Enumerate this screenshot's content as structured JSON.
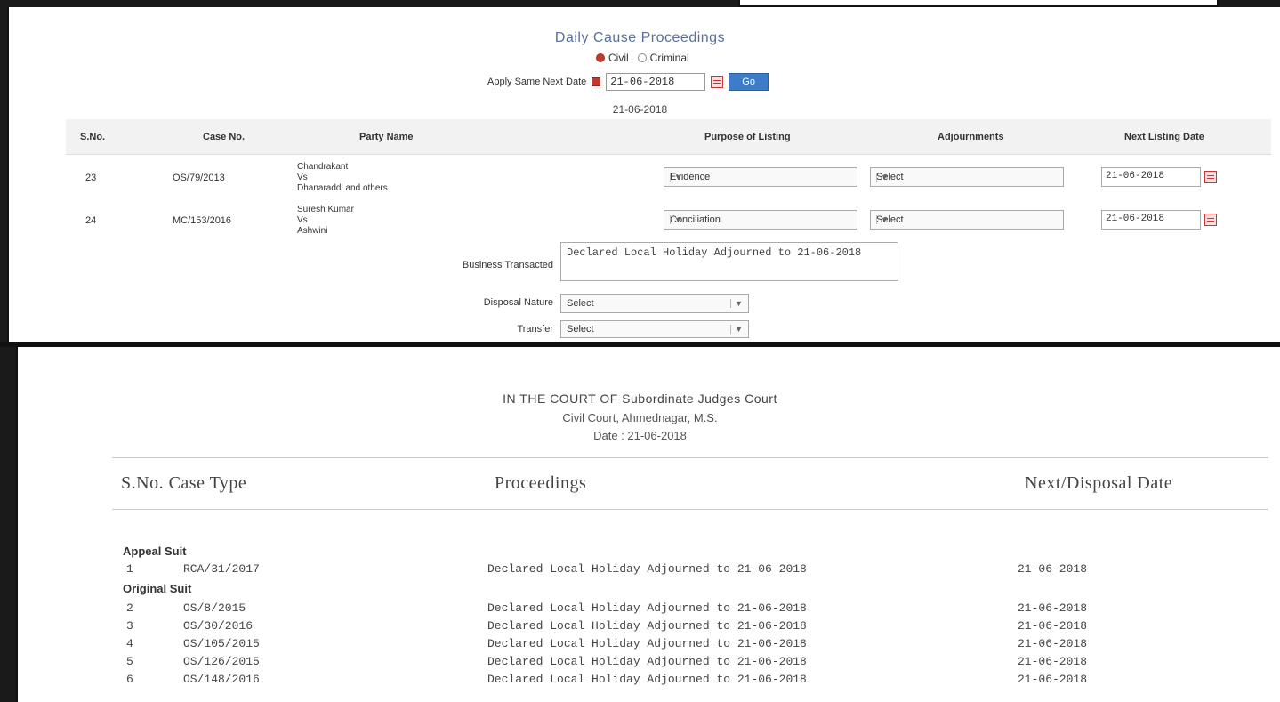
{
  "top": {
    "title": "Daily Cause Proceedings",
    "radio_1": "Civil",
    "radio_2": "Criminal",
    "same_next_date_label": "Apply Same Next Date",
    "same_next_date_value": "21-06-2018",
    "go_button": "Go",
    "selected_date": "21-06-2018",
    "columns": [
      "S.No.",
      "Case No.",
      "Party Name",
      "Purpose of Listing",
      "Adjournments",
      "Next Listing Date"
    ],
    "rows": [
      {
        "sno": "23",
        "case_no": "OS/79/2013",
        "party": [
          "Chandrakant",
          "Vs",
          "Dhanaraddi and others"
        ],
        "purpose": "Evidence",
        "adjourn": "Select",
        "next_date": "21-06-2018"
      },
      {
        "sno": "24",
        "case_no": "MC/153/2016",
        "party": [
          "Suresh Kumar",
          "Vs",
          "Ashwini"
        ],
        "purpose": "Conciliation",
        "adjourn": "Select",
        "next_date": "21-06-2018"
      }
    ],
    "business_label": "Business Transacted",
    "business_value": "Declared Local Holiday Adjourned to 21-06-2018",
    "disposal_label": "Disposal Nature",
    "disposal_value": "Select",
    "transfer_label": "Transfer",
    "transfer_value": "Select"
  },
  "bottom": {
    "court_line1": "IN THE COURT OF Subordinate Judges Court",
    "court_line2": "Civil Court, Ahmednagar, M.S.",
    "court_line3": "Date : 21-06-2018",
    "col_sno_type": "S.No. Case Type",
    "col_proceedings": "Proceedings",
    "col_next": "Next/Disposal Date",
    "groups": [
      {
        "name": "Appeal Suit",
        "items": [
          {
            "sno": "1",
            "case": "RCA/31/2017",
            "proc": "Declared Local Holiday Adjourned to 21-06-2018",
            "date": "21-06-2018"
          }
        ]
      },
      {
        "name": "Original Suit",
        "items": [
          {
            "sno": "2",
            "case": "OS/8/2015",
            "proc": "Declared Local Holiday Adjourned to 21-06-2018",
            "date": "21-06-2018"
          },
          {
            "sno": "3",
            "case": "OS/30/2016",
            "proc": "Declared Local Holiday Adjourned to 21-06-2018",
            "date": "21-06-2018"
          },
          {
            "sno": "4",
            "case": "OS/105/2015",
            "proc": "Declared Local Holiday Adjourned to 21-06-2018",
            "date": "21-06-2018"
          },
          {
            "sno": "5",
            "case": "OS/126/2015",
            "proc": "Declared Local Holiday Adjourned to 21-06-2018",
            "date": "21-06-2018"
          },
          {
            "sno": "6",
            "case": "OS/148/2016",
            "proc": "Declared Local Holiday Adjourned to 21-06-2018",
            "date": "21-06-2018"
          }
        ]
      }
    ]
  }
}
